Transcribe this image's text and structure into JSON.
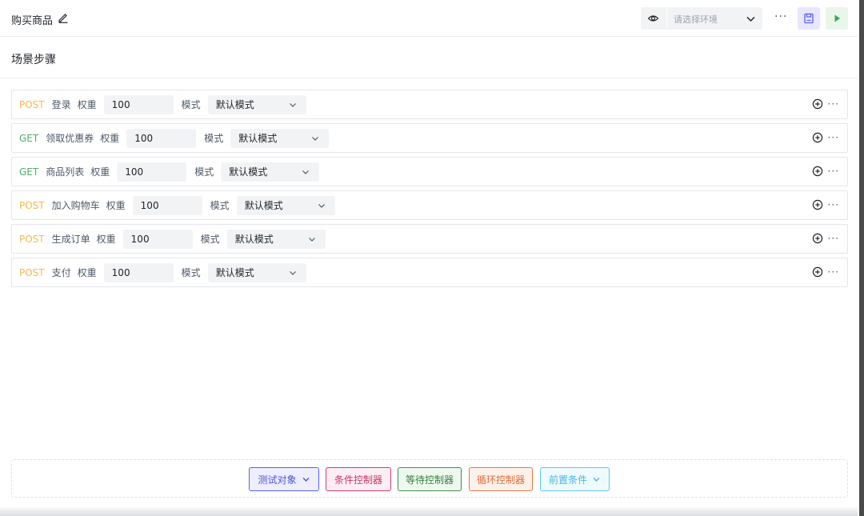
{
  "header": {
    "title": "购买商品",
    "env_placeholder": "请选择环境",
    "more": "···"
  },
  "section": {
    "title": "场景步骤"
  },
  "labels": {
    "weight": "权重",
    "mode": "模式"
  },
  "steps": [
    {
      "method": "POST",
      "name": "登录",
      "weight": "100",
      "mode": "默认模式"
    },
    {
      "method": "GET",
      "name": "领取优惠券",
      "weight": "100",
      "mode": "默认模式"
    },
    {
      "method": "GET",
      "name": "商品列表",
      "weight": "100",
      "mode": "默认模式"
    },
    {
      "method": "POST",
      "name": "加入购物车",
      "weight": "100",
      "mode": "默认模式"
    },
    {
      "method": "POST",
      "name": "生成订单",
      "weight": "100",
      "mode": "默认模式"
    },
    {
      "method": "POST",
      "name": "支付",
      "weight": "100",
      "mode": "默认模式"
    }
  ],
  "step_more": "···",
  "footer": {
    "test_object": "测试对象",
    "condition_controller": "条件控制器",
    "wait_controller": "等待控制器",
    "loop_controller": "循环控制器",
    "precondition": "前置条件"
  },
  "colors": {
    "post": "#f7b94a",
    "get": "#4caf6a",
    "test_object": "#5b5fe8",
    "condition": "#d63c6b",
    "wait": "#3f8f4a",
    "loop": "#e57a42",
    "precondition": "#5ec8e8"
  }
}
